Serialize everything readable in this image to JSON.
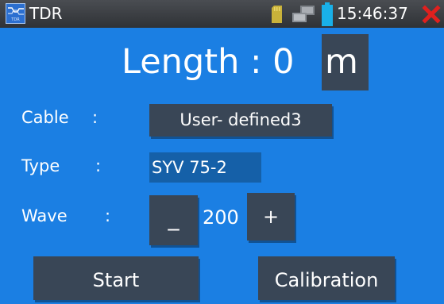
{
  "titlebar": {
    "app_icon_caption": "TDR",
    "title": "TDR",
    "time": "15:46:37",
    "icons": [
      "sd-card-icon",
      "network-icon",
      "battery-icon",
      "close-icon"
    ]
  },
  "length": {
    "text": "Length : 0",
    "unit": "m"
  },
  "cable": {
    "label": "Cable",
    "colon": ":",
    "value": "User- defined3"
  },
  "type": {
    "label": "Type",
    "colon": ":",
    "value": "SYV 75-2"
  },
  "wave": {
    "label": "Wave",
    "colon": ":",
    "minus_label": "_",
    "value": "200",
    "plus_label": "+"
  },
  "buttons": {
    "start": "Start",
    "calibration": "Calibration"
  },
  "colors": {
    "background": "#1b7fe3",
    "titlebar": "#3a3d42",
    "button": "#394656",
    "type_field": "#1560a8",
    "close": "#e0201e",
    "battery": "#19b0e8",
    "sd_card": "#c9b23a"
  }
}
